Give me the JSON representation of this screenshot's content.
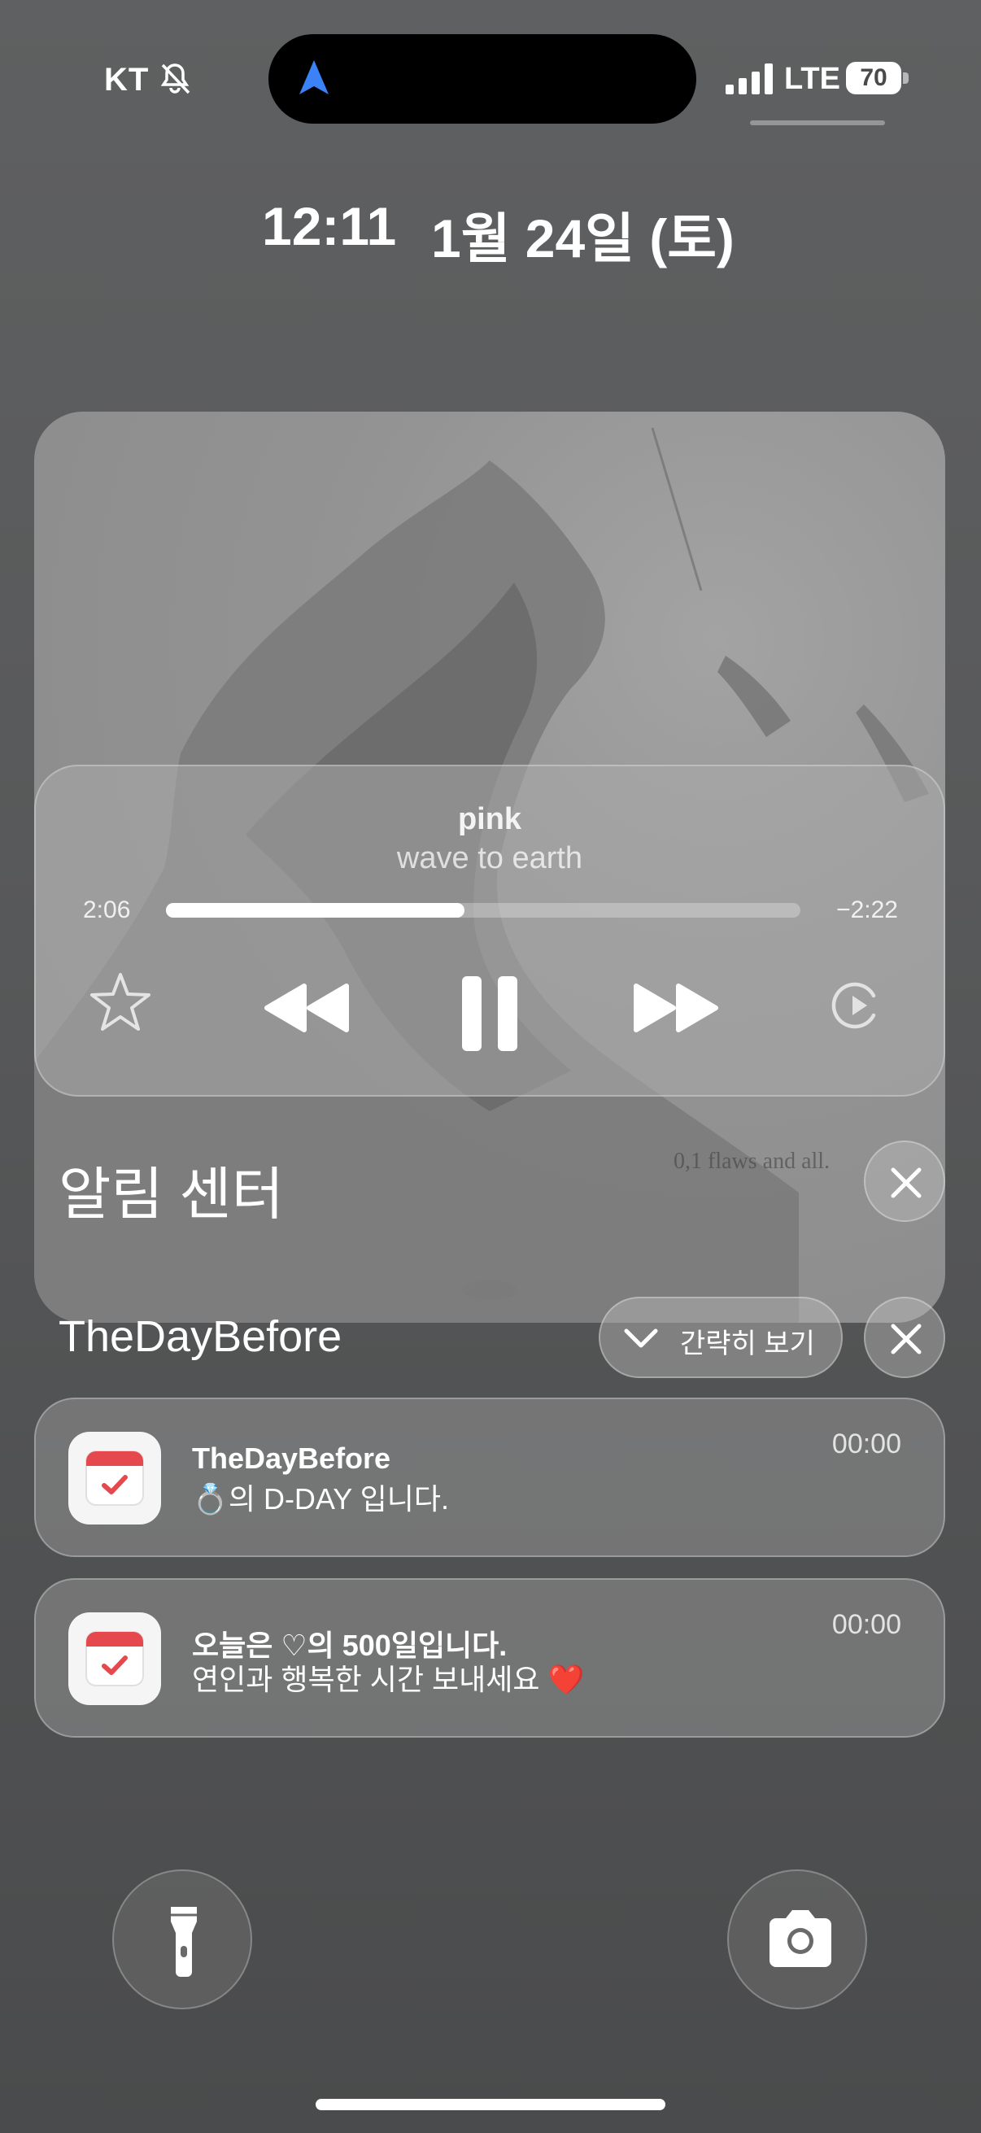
{
  "status_bar": {
    "carrier": "KT",
    "network": "LTE",
    "battery": "70",
    "icons": [
      "bell-slash-icon",
      "navigation-arrow-icon",
      "signal-bars-icon",
      "battery-icon"
    ]
  },
  "lock": {
    "time": "12:11",
    "date": "1월 24일 (토)"
  },
  "album": {
    "text": "0,1 flaws and all.",
    "colors": {
      "card": "#8f8f8f"
    }
  },
  "player": {
    "song": "pink",
    "artist": "wave to earth",
    "elapsed": "2:06",
    "remaining": "−2:22",
    "progress": 0.47,
    "icons": [
      "star-icon",
      "rewind-icon",
      "pause-icon",
      "fast-forward-icon",
      "airplay-icon"
    ]
  },
  "notification_center": {
    "title": "알림 센터",
    "group": {
      "title": "TheDayBefore",
      "collapse_label": "간략히 보기"
    },
    "notifications": [
      {
        "title": "TheDayBefore",
        "body": "💍의 D-DAY 입니다.",
        "time": "00:00"
      },
      {
        "title": "오늘은 ♡의 500일입니다.",
        "body": "연인과 행복한 시간 보내세요 ❤️",
        "time": "00:00"
      }
    ]
  },
  "bottom": {
    "icons": [
      "flashlight-icon",
      "camera-icon"
    ]
  },
  "colors": {
    "background": "#58595a",
    "accent_nav": "#3b82f6",
    "calendar_red": "#e5484d"
  }
}
